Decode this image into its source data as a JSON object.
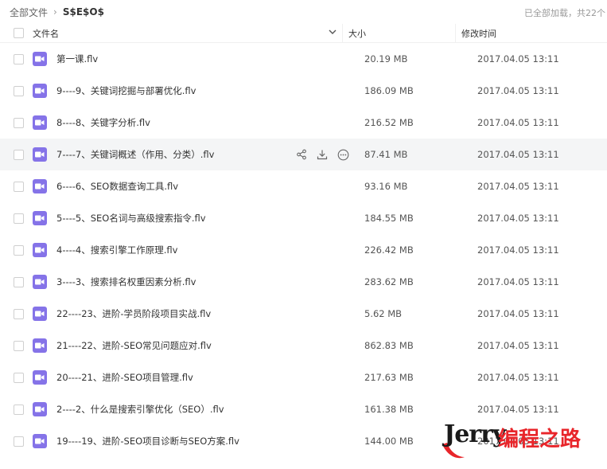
{
  "breadcrumb": {
    "root": "全部文件",
    "separator": "›",
    "current": "S$E$O$"
  },
  "status": {
    "load_text": "已全部加载，共22个"
  },
  "table": {
    "columns": {
      "name": "文件名",
      "size": "大小",
      "modified": "修改时间"
    },
    "sort_icon": "chevron-down-icon",
    "rows": [
      {
        "name": "第一课.flv",
        "size": "20.19 MB",
        "time": "2017.04.05 13:11"
      },
      {
        "name": "9----9、关键词挖掘与部署优化.flv",
        "size": "186.09 MB",
        "time": "2017.04.05 13:11"
      },
      {
        "name": "8----8、关键字分析.flv",
        "size": "216.52 MB",
        "time": "2017.04.05 13:11"
      },
      {
        "name": "7----7、关键词概述（作用、分类）.flv",
        "size": "87.41 MB",
        "time": "2017.04.05 13:11"
      },
      {
        "name": "6----6、SEO数据查询工具.flv",
        "size": "93.16 MB",
        "time": "2017.04.05 13:11"
      },
      {
        "name": "5----5、SEO名词与高级搜索指令.flv",
        "size": "184.55 MB",
        "time": "2017.04.05 13:11"
      },
      {
        "name": "4----4、搜索引擎工作原理.flv",
        "size": "226.42 MB",
        "time": "2017.04.05 13:11"
      },
      {
        "name": "3----3、搜索排名权重因素分析.flv",
        "size": "283.62 MB",
        "time": "2017.04.05 13:11"
      },
      {
        "name": "22----23、进阶-学员阶段项目实战.flv",
        "size": "5.62 MB",
        "time": "2017.04.05 13:11"
      },
      {
        "name": "21----22、进阶-SEO常见问题应对.flv",
        "size": "862.83 MB",
        "time": "2017.04.05 13:11"
      },
      {
        "name": "20----21、进阶-SEO项目管理.flv",
        "size": "217.63 MB",
        "time": "2017.04.05 13:11"
      },
      {
        "name": "2----2、什么是搜索引擎优化（SEO）.flv",
        "size": "161.38 MB",
        "time": "2017.04.05 13:11"
      },
      {
        "name": "19----19、进阶-SEO项目诊断与SEO方案.flv",
        "size": "144.00 MB",
        "time": "2017.04.05 13:11"
      }
    ],
    "hover_row_index": 3,
    "row_actions": [
      "share-icon",
      "download-icon",
      "more-icon"
    ]
  },
  "colors": {
    "file_icon": "#8573e8",
    "hover_row": "#f4f5f6",
    "watermark_red": "#e8252a"
  },
  "watermark": {
    "brand": "Jerry",
    "text": "编程之路"
  }
}
